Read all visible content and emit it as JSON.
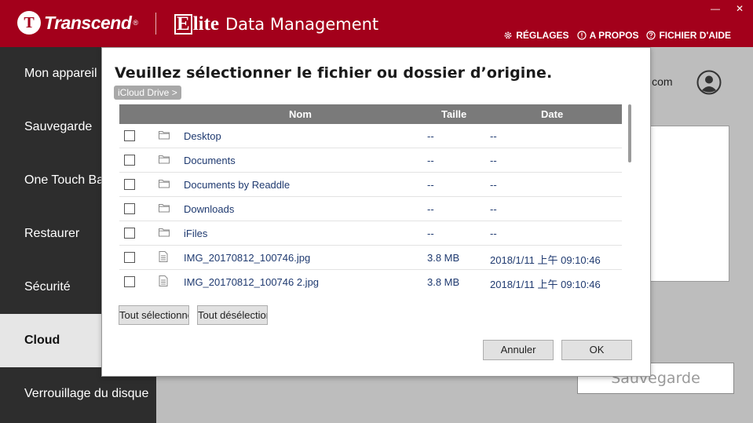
{
  "header": {
    "brand": "Transcend",
    "brand_mark": "T",
    "brand_reg": "®",
    "app_elite_prefix": "E",
    "app_elite_rest": "lite",
    "app_title": "Data Management",
    "window_minimize": "—",
    "window_close": "✕",
    "menu": [
      {
        "label": "RÉGLAGES",
        "icon": "gear-icon"
      },
      {
        "label": "A PROPOS",
        "icon": "info-icon"
      },
      {
        "label": "FICHIER D'AIDE",
        "icon": "help-icon"
      }
    ]
  },
  "sidebar": {
    "items": [
      {
        "label": "Mon appareil"
      },
      {
        "label": "Sauvegarde"
      },
      {
        "label": "One Touch Backup"
      },
      {
        "label": "Restaurer"
      },
      {
        "label": "Sécurité"
      },
      {
        "label": "Cloud",
        "active": true
      },
      {
        "label": "Verrouillage du disque"
      }
    ]
  },
  "main": {
    "email_partial": "il.com",
    "save_button": "Sauvegarde"
  },
  "dialog": {
    "title": "Veuillez sélectionner le fichier ou dossier d’origine.",
    "breadcrumb": "iCloud Drive >",
    "columns": {
      "name": "Nom",
      "size": "Taille",
      "date": "Date"
    },
    "rows": [
      {
        "type": "folder",
        "name": "Desktop",
        "size": "--",
        "date": "--"
      },
      {
        "type": "folder",
        "name": "Documents",
        "size": "--",
        "date": "--"
      },
      {
        "type": "folder",
        "name": "Documents by Readdle",
        "size": "--",
        "date": "--"
      },
      {
        "type": "folder",
        "name": "Downloads",
        "size": "--",
        "date": "--"
      },
      {
        "type": "folder",
        "name": "iFiles",
        "size": "--",
        "date": "--"
      },
      {
        "type": "file",
        "name": "IMG_20170812_100746.jpg",
        "size": "3.8 MB",
        "date": "2018/1/11 上午 09:10:46"
      },
      {
        "type": "file",
        "name": "IMG_20170812_100746 2.jpg",
        "size": "3.8 MB",
        "date": "2018/1/11 上午 09:10:46"
      }
    ],
    "select_all": "Tout sélectionner",
    "deselect_all": "Tout désélectionner",
    "cancel": "Annuler",
    "ok": "OK"
  },
  "colors": {
    "brand_red": "#a3001b",
    "sidebar_bg": "#2d2d2d",
    "header_row_bg": "#7a7a7a",
    "link_text": "#1f3a70"
  }
}
